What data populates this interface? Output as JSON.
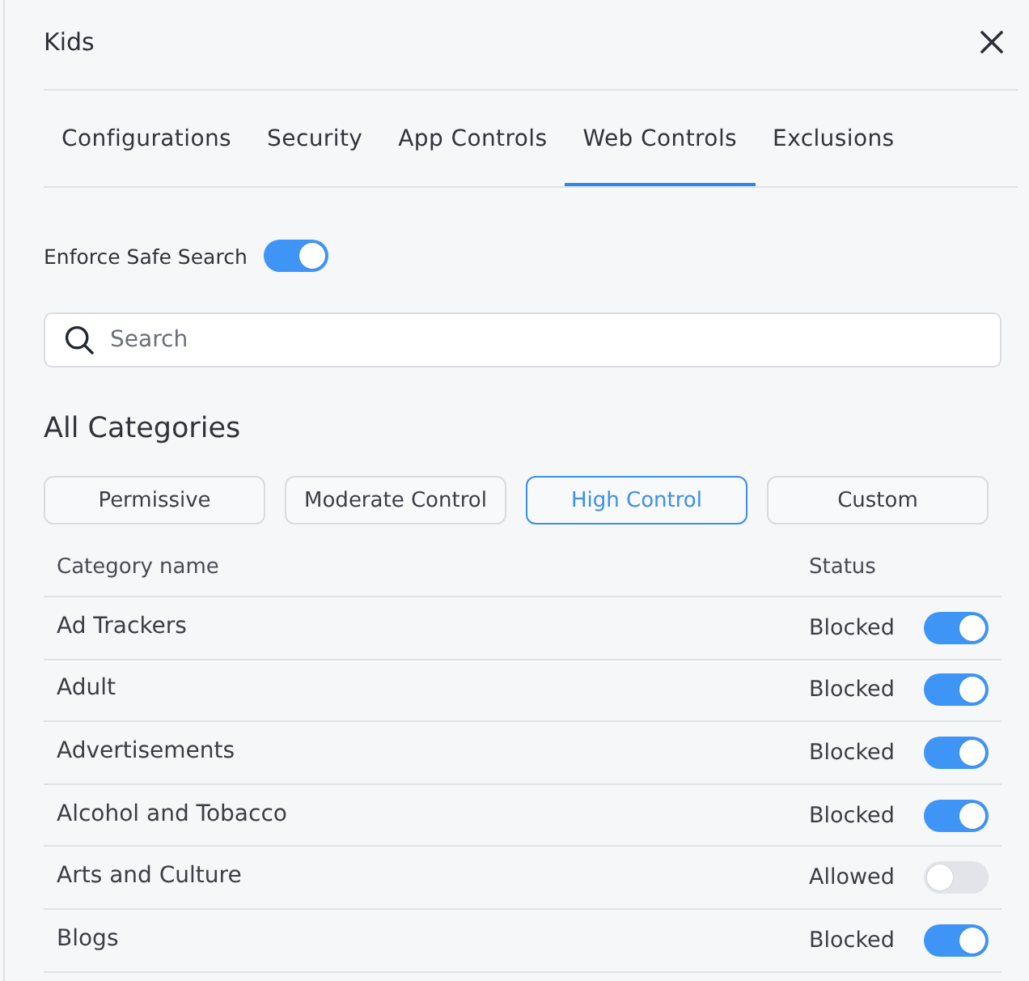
{
  "panel": {
    "title": "Kids"
  },
  "tabs": [
    {
      "label": "Configurations",
      "selected": false
    },
    {
      "label": "Security",
      "selected": false
    },
    {
      "label": "App Controls",
      "selected": false
    },
    {
      "label": "Web Controls",
      "selected": true
    },
    {
      "label": "Exclusions",
      "selected": false
    }
  ],
  "safe_search": {
    "label": "Enforce Safe Search",
    "on": true
  },
  "search": {
    "placeholder": "Search"
  },
  "categories": {
    "heading": "All Categories",
    "presets": [
      {
        "label": "Permissive",
        "selected": false
      },
      {
        "label": "Moderate Control",
        "selected": false
      },
      {
        "label": "High Control",
        "selected": true
      },
      {
        "label": "Custom",
        "selected": false
      }
    ],
    "columns": [
      "Category name",
      "Status"
    ],
    "rows": [
      {
        "name": "Ad Trackers",
        "status": "Blocked",
        "on": true
      },
      {
        "name": "Adult",
        "status": "Blocked",
        "on": true
      },
      {
        "name": "Advertisements",
        "status": "Blocked",
        "on": true
      },
      {
        "name": "Alcohol and Tobacco",
        "status": "Blocked",
        "on": true
      },
      {
        "name": "Arts and Culture",
        "status": "Allowed",
        "on": false
      },
      {
        "name": "Blogs",
        "status": "Blocked",
        "on": true
      }
    ]
  }
}
